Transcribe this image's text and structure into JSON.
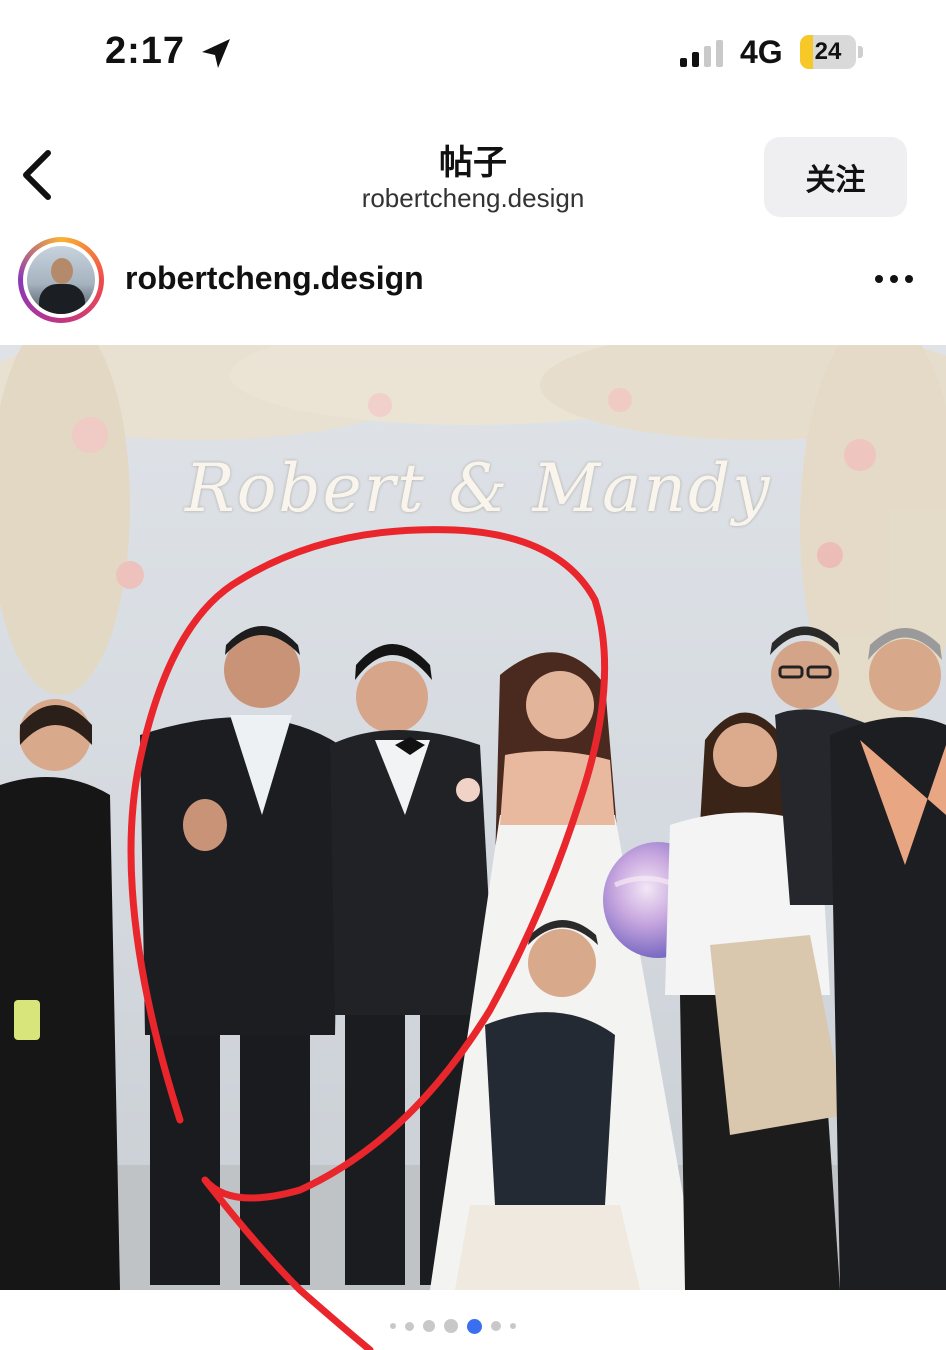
{
  "status_bar": {
    "time": "2:17",
    "network": "4G",
    "battery_level": "24",
    "battery_fraction": 0.24,
    "location_icon": "location-arrow-icon",
    "signal_icon": "cellular-signal-icon"
  },
  "nav": {
    "title": "帖子",
    "subtitle": "robertcheng.design",
    "follow_label": "关注",
    "back_icon": "chevron-left-icon"
  },
  "post": {
    "username": "robertcheng.design",
    "more_icon": "more-horizontal-icon",
    "backdrop_text": "Robert & Mandy",
    "carousel": {
      "count": 7,
      "active_index": 4
    }
  },
  "colors": {
    "annotation": "#e8262b",
    "battery_fill": "#f7c928",
    "active_dot": "#3a6ff0",
    "inactive_dot": "#c8c8c8"
  }
}
